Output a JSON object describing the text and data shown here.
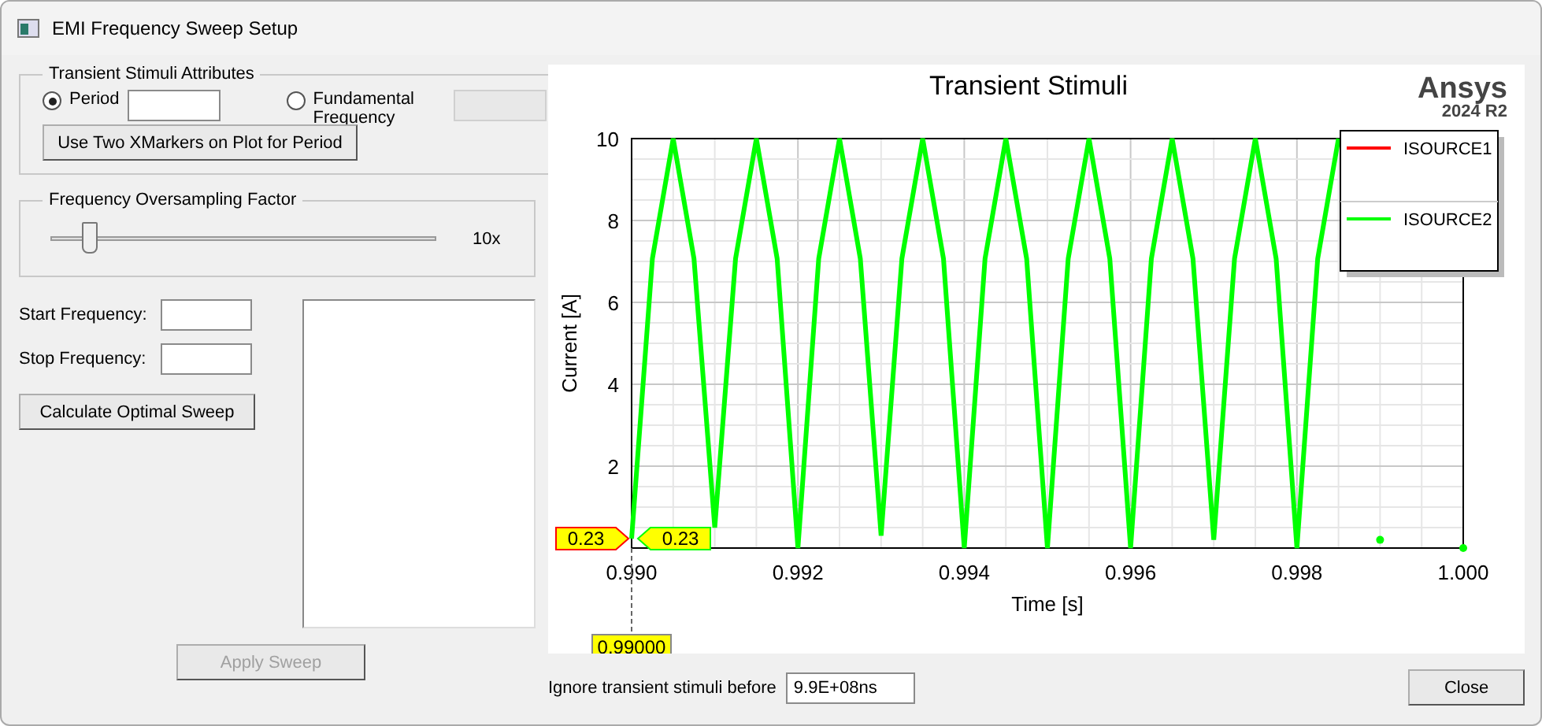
{
  "window": {
    "title": "EMI Frequency Sweep Setup"
  },
  "stimuli_group": {
    "title": "Transient Stimuli Attributes",
    "options": [
      {
        "label": "Period",
        "selected": true,
        "disabled": false
      },
      {
        "label": "Fundamental Frequency",
        "selected": false,
        "disabled": true
      }
    ],
    "button": "Use Two XMarkers on Plot for Period"
  },
  "oversampling_group": {
    "title": "Frequency Oversampling Factor",
    "level": 0.1,
    "reading": "10x"
  },
  "frequency_fields": [
    {
      "label": "Start Frequency:"
    },
    {
      "label": "Stop Frequency:"
    }
  ],
  "calculate_button": "Calculate Optimal Sweep",
  "apply_button": {
    "label": "Apply Sweep",
    "disabled": true
  },
  "plot": {
    "brand": "Ansys",
    "version": "2024 R2",
    "chart_data": {
      "type": "line",
      "title": "Transient Stimuli",
      "xlabel": "Time [s]",
      "ylabel": "Current [A]",
      "xlim": [
        0.99,
        1.0
      ],
      "ylim": [
        0,
        10
      ],
      "xticks": [
        {
          "value": 0.99,
          "label": "0.990"
        },
        {
          "value": 0.992,
          "label": "0.992"
        },
        {
          "value": 0.994,
          "label": "0.994"
        },
        {
          "value": 0.996,
          "label": "0.996"
        },
        {
          "value": 0.998,
          "label": "0.998"
        },
        {
          "value": 1.0,
          "label": "1.000"
        }
      ],
      "yticks": [
        2,
        4,
        6,
        8,
        10
      ],
      "grid": true,
      "legend": true,
      "x": [
        0.99,
        0.99025,
        0.9905,
        0.99075,
        0.991,
        0.99125,
        0.9915,
        0.99175,
        0.992,
        0.99225,
        0.9925,
        0.99275,
        0.993,
        0.99325,
        0.9935,
        0.99375,
        0.994,
        0.99425,
        0.9945,
        0.99475,
        0.995,
        0.99525,
        0.9955,
        0.99575,
        0.996,
        0.99625,
        0.9965,
        0.99675,
        0.997,
        0.99725,
        0.9975,
        0.99775,
        0.998,
        0.99825,
        0.9985,
        0.99875,
        0.999,
        0.99925,
        0.9995,
        0.99975,
        1.0
      ],
      "series": [
        {
          "name": "ISOURCE1",
          "color": "#ff0000",
          "values": [
            null,
            null,
            null,
            null,
            null,
            null,
            null,
            null,
            null,
            null,
            null,
            null,
            null,
            null,
            null,
            null,
            null,
            null,
            null,
            null,
            null,
            null,
            null,
            null,
            null,
            null,
            null,
            null,
            null,
            null,
            null,
            null,
            null,
            null,
            null,
            null,
            null,
            null,
            null,
            null,
            null
          ]
        },
        {
          "name": "ISOURCE2",
          "color": "#00ff00",
          "values": [
            0.23,
            7.07,
            10,
            7.07,
            0.5,
            7.07,
            10,
            7.07,
            0,
            7.07,
            10,
            7.07,
            0.3,
            7.07,
            10,
            7.07,
            0,
            7.07,
            10,
            7.07,
            0,
            7.07,
            10,
            7.07,
            0,
            7.07,
            10,
            7.07,
            0.2,
            7.07,
            10,
            7.07,
            0,
            7.07,
            10,
            null,
            0.2,
            null,
            null,
            null,
            0
          ]
        }
      ]
    },
    "marker": {
      "x_label": "0.99000",
      "values": [
        {
          "text": "0.23",
          "color": "#ff0000"
        },
        {
          "text": "0.23",
          "color": "#00ff00"
        }
      ]
    }
  },
  "ignore_field": {
    "label": "Ignore transient stimuli before",
    "value": "9.9E+08ns"
  },
  "close_button": "Close"
}
